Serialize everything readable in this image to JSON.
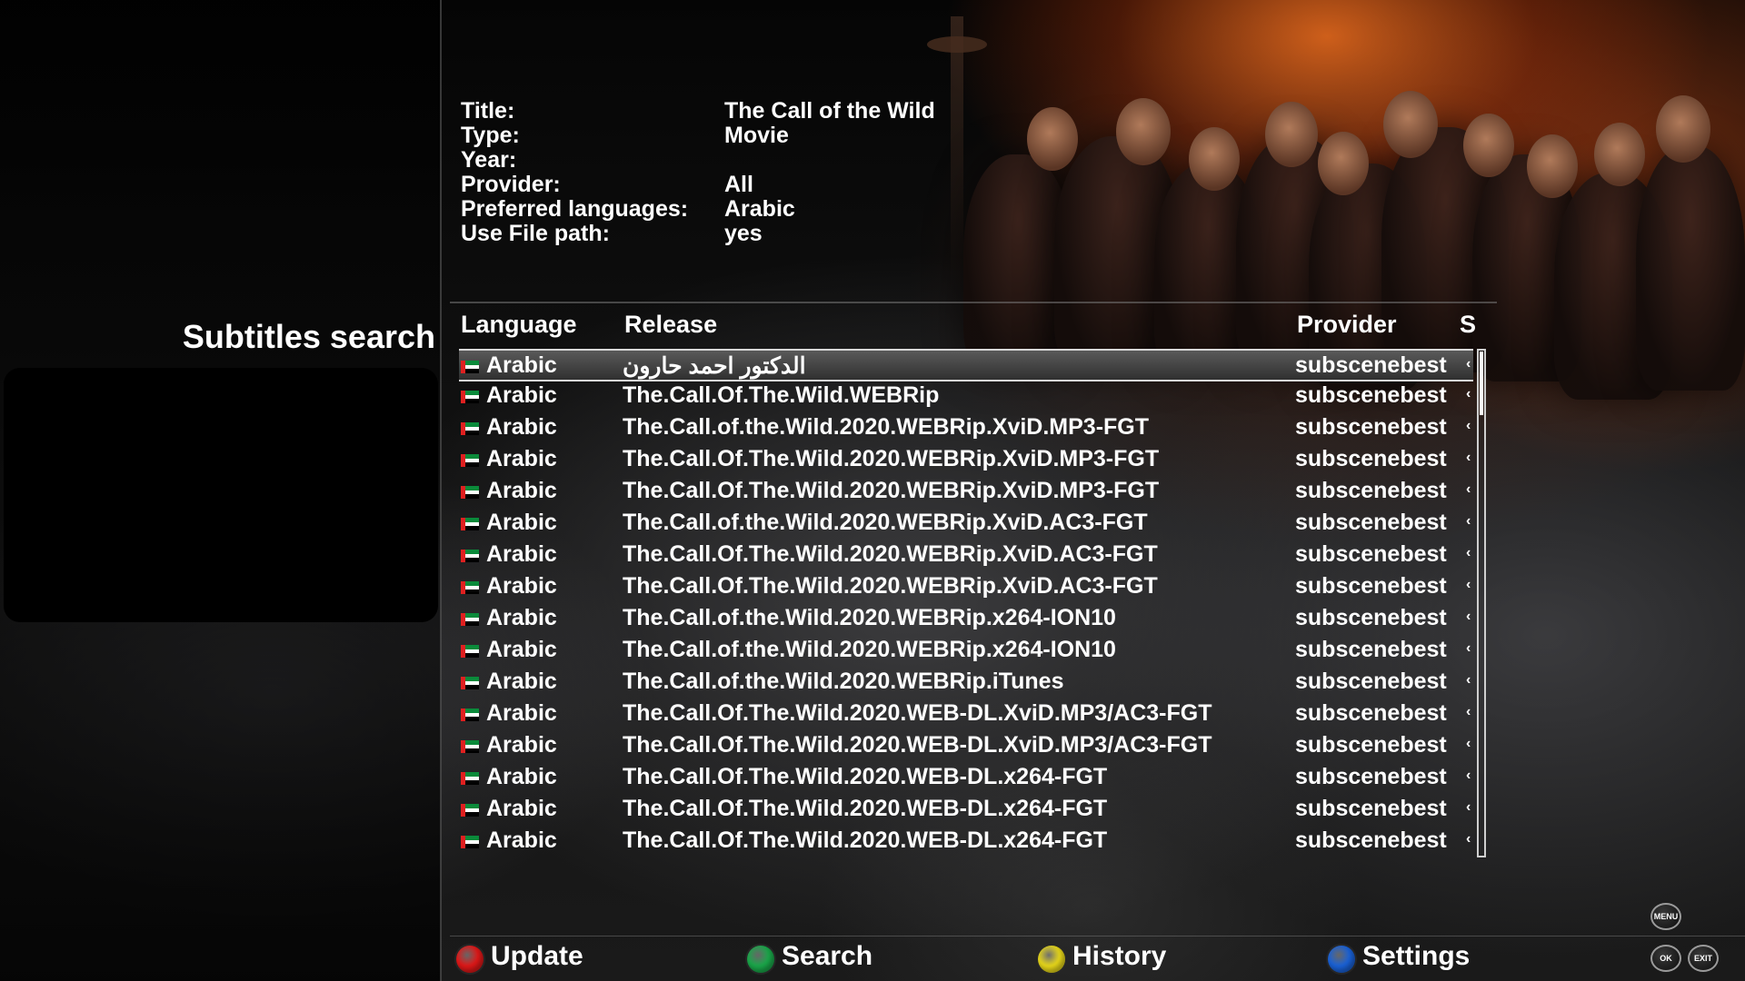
{
  "screen": {
    "title": "Subtitles search"
  },
  "info": {
    "rows": [
      {
        "label": "Title:",
        "value": "The Call of the Wild"
      },
      {
        "label": "Type:",
        "value": "Movie"
      },
      {
        "label": "Year:",
        "value": ""
      },
      {
        "label": "Provider:",
        "value": "All"
      },
      {
        "label": "Preferred languages:",
        "value": "Arabic"
      },
      {
        "label": "Use File path:",
        "value": "yes"
      }
    ]
  },
  "table": {
    "headers": {
      "language": "Language",
      "release": "Release",
      "provider": "Provider",
      "score": "S"
    },
    "selected_index": 0,
    "rows": [
      {
        "language": "Arabic",
        "release": "الدكتور احمد حارون",
        "provider": "subscenebest",
        "score": "‹"
      },
      {
        "language": "Arabic",
        "release": "The.Call.Of.The.Wild.WEBRip",
        "provider": "subscenebest",
        "score": "‹"
      },
      {
        "language": "Arabic",
        "release": "The.Call.of.the.Wild.2020.WEBRip.XviD.MP3-FGT",
        "provider": "subscenebest",
        "score": "‹"
      },
      {
        "language": "Arabic",
        "release": "The.Call.Of.The.Wild.2020.WEBRip.XviD.MP3-FGT",
        "provider": "subscenebest",
        "score": "‹"
      },
      {
        "language": "Arabic",
        "release": "The.Call.Of.The.Wild.2020.WEBRip.XviD.MP3-FGT",
        "provider": "subscenebest",
        "score": "‹"
      },
      {
        "language": "Arabic",
        "release": "The.Call.of.the.Wild.2020.WEBRip.XviD.AC3-FGT",
        "provider": "subscenebest",
        "score": "‹"
      },
      {
        "language": "Arabic",
        "release": "The.Call.Of.The.Wild.2020.WEBRip.XviD.AC3-FGT",
        "provider": "subscenebest",
        "score": "‹"
      },
      {
        "language": "Arabic",
        "release": "The.Call.Of.The.Wild.2020.WEBRip.XviD.AC3-FGT",
        "provider": "subscenebest",
        "score": "‹"
      },
      {
        "language": "Arabic",
        "release": "The.Call.of.the.Wild.2020.WEBRip.x264-ION10",
        "provider": "subscenebest",
        "score": "‹"
      },
      {
        "language": "Arabic",
        "release": "The.Call.of.the.Wild.2020.WEBRip.x264-ION10",
        "provider": "subscenebest",
        "score": "‹"
      },
      {
        "language": "Arabic",
        "release": "The.Call.of.the.Wild.2020.WEBRip.iTunes",
        "provider": "subscenebest",
        "score": "‹"
      },
      {
        "language": "Arabic",
        "release": "The.Call.Of.The.Wild.2020.WEB-DL.XviD.MP3/AC3-FGT",
        "provider": "subscenebest",
        "score": "‹"
      },
      {
        "language": "Arabic",
        "release": "The.Call.Of.The.Wild.2020.WEB-DL.XviD.MP3/AC3-FGT",
        "provider": "subscenebest",
        "score": "‹"
      },
      {
        "language": "Arabic",
        "release": "The.Call.Of.The.Wild.2020.WEB-DL.x264-FGT",
        "provider": "subscenebest",
        "score": "‹"
      },
      {
        "language": "Arabic",
        "release": "The.Call.Of.The.Wild.2020.WEB-DL.x264-FGT",
        "provider": "subscenebest",
        "score": "‹"
      },
      {
        "language": "Arabic",
        "release": "The.Call.Of.The.Wild.2020.WEB-DL.x264-FGT",
        "provider": "subscenebest",
        "score": "‹"
      }
    ],
    "flag_icon": "uae-flag-icon",
    "scroll_fraction": 0.0
  },
  "footer": {
    "buttons": [
      {
        "label": "Update",
        "color": "#e01818",
        "icon": "red-button-icon"
      },
      {
        "label": "Search",
        "color": "#1aa84a",
        "icon": "green-button-icon"
      },
      {
        "label": "History",
        "color": "#e8d81a",
        "icon": "yellow-button-icon"
      },
      {
        "label": "Settings",
        "color": "#1a62d8",
        "icon": "blue-button-icon"
      }
    ],
    "keys": {
      "menu": "MENU",
      "ok": "OK",
      "exit": "EXIT"
    }
  }
}
